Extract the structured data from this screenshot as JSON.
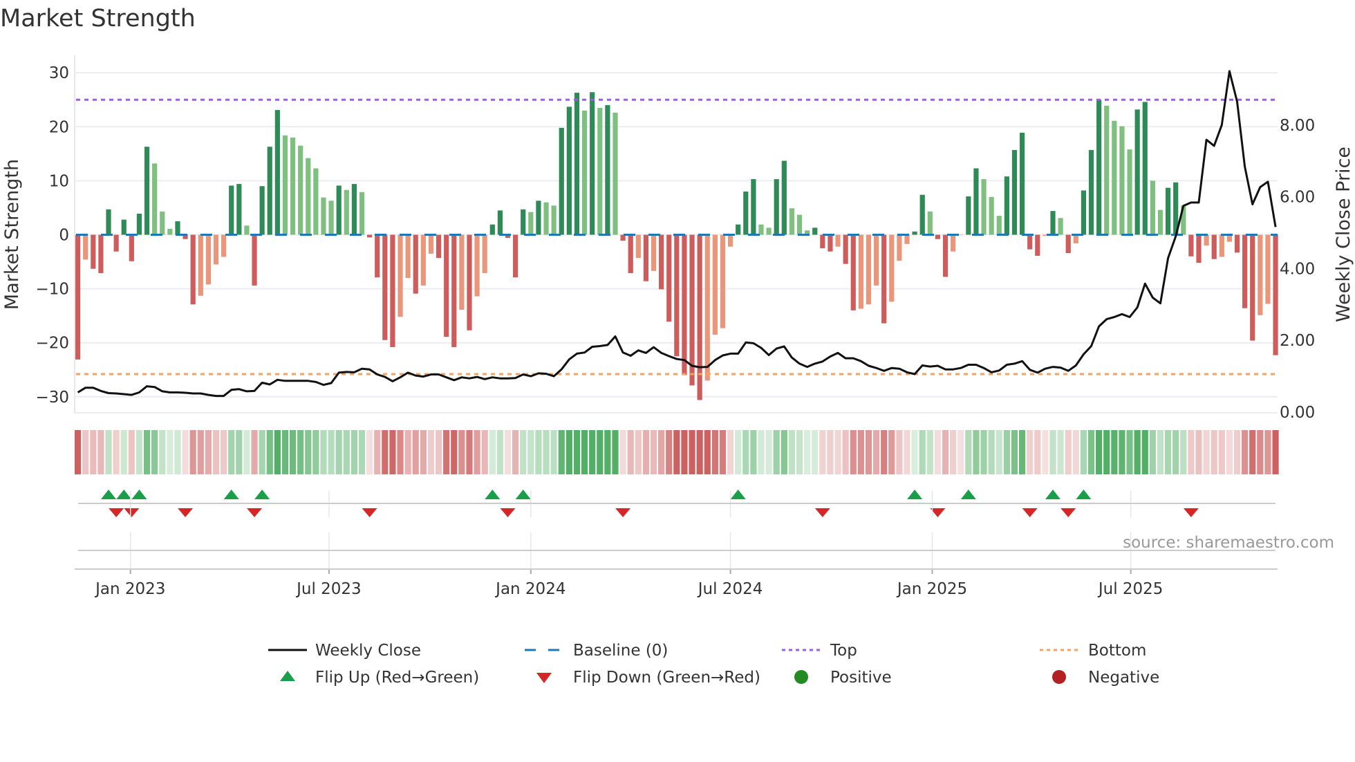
{
  "title": "Market Strength",
  "source": "source: sharemaestro.com",
  "colors": {
    "positive_rising": "#2e8b57",
    "positive_falling": "#7fbf7f",
    "negative_falling": "#cd5c5c",
    "negative_rising": "#e9967a",
    "baseline": "#1f77b4",
    "top": "#9b5de5",
    "bottom": "#f4a261",
    "flip_up": "#1a9e4a",
    "flip_down": "#d62728",
    "positive": "#228b22",
    "negative": "#b22222",
    "price_line": "#111111"
  },
  "legend": [
    {
      "label": "Weekly Close",
      "symbol": "solid-line"
    },
    {
      "label": "Baseline (0)",
      "symbol": "dashed-line"
    },
    {
      "label": "Top",
      "symbol": "dotted-line-purple"
    },
    {
      "label": "Bottom",
      "symbol": "dotted-line-orange"
    },
    {
      "label": "Flip Up (Red→Green)",
      "symbol": "triangle-up"
    },
    {
      "label": "Flip Down (Green→Red)",
      "symbol": "triangle-down"
    },
    {
      "label": "Positive",
      "symbol": "circle-green"
    },
    {
      "label": "Negative",
      "symbol": "circle-red"
    }
  ],
  "chart_data": {
    "type": "bar",
    "ylabel": "Market Strength",
    "y2label": "Weekly Close Price",
    "ylim": [
      -33,
      33
    ],
    "y2lim": [
      0,
      9.9
    ],
    "yticks": [
      {
        "value": 30,
        "label": "30"
      },
      {
        "value": 20,
        "label": "20"
      },
      {
        "value": 10,
        "label": "10"
      },
      {
        "value": 0,
        "label": "0"
      },
      {
        "value": -10,
        "label": "−10"
      },
      {
        "value": -20,
        "label": "−20"
      },
      {
        "value": -30,
        "label": "−30"
      }
    ],
    "y2ticks": [
      {
        "value": 0,
        "label": "0.00"
      },
      {
        "value": 2,
        "label": "2.00"
      },
      {
        "value": 4,
        "label": "4.00"
      },
      {
        "value": 6,
        "label": "6.00"
      },
      {
        "value": 8,
        "label": "8.00"
      }
    ],
    "xticks": [
      {
        "date": "2023-01-01",
        "label": "Jan 2023"
      },
      {
        "date": "2023-07-01",
        "label": "Jul 2023"
      },
      {
        "date": "2024-01-01",
        "label": "Jan 2024"
      },
      {
        "date": "2024-07-01",
        "label": "Jul 2024"
      },
      {
        "date": "2025-01-01",
        "label": "Jan 2025"
      },
      {
        "date": "2025-07-01",
        "label": "Jul 2025"
      }
    ],
    "grid": true,
    "legend_position": "bottom",
    "top_level": 25,
    "bottom_level": -25.8,
    "baseline": 0,
    "dates": [
      "2022-11-14",
      "2022-11-21",
      "2022-11-28",
      "2022-12-05",
      "2022-12-12",
      "2022-12-19",
      "2022-12-26",
      "2023-01-02",
      "2023-01-09",
      "2023-01-16",
      "2023-01-23",
      "2023-01-30",
      "2023-02-06",
      "2023-02-13",
      "2023-02-20",
      "2023-02-27",
      "2023-03-06",
      "2023-03-13",
      "2023-03-20",
      "2023-03-27",
      "2023-04-03",
      "2023-04-10",
      "2023-04-17",
      "2023-04-24",
      "2023-05-01",
      "2023-05-08",
      "2023-05-15",
      "2023-05-22",
      "2023-05-29",
      "2023-06-05",
      "2023-06-12",
      "2023-06-19",
      "2023-06-26",
      "2023-07-03",
      "2023-07-10",
      "2023-07-17",
      "2023-07-24",
      "2023-07-31",
      "2023-08-07",
      "2023-08-14",
      "2023-08-21",
      "2023-08-28",
      "2023-09-04",
      "2023-09-11",
      "2023-09-18",
      "2023-09-25",
      "2023-10-02",
      "2023-10-09",
      "2023-10-16",
      "2023-10-23",
      "2023-10-30",
      "2023-11-06",
      "2023-11-13",
      "2023-11-20",
      "2023-11-27",
      "2023-12-04",
      "2023-12-11",
      "2023-12-18",
      "2023-12-25",
      "2024-01-01",
      "2024-01-08",
      "2024-01-15",
      "2024-01-22",
      "2024-01-29",
      "2024-02-05",
      "2024-02-12",
      "2024-02-19",
      "2024-02-26",
      "2024-03-04",
      "2024-03-11",
      "2024-03-18",
      "2024-03-25",
      "2024-04-01",
      "2024-04-08",
      "2024-04-15",
      "2024-04-22",
      "2024-04-29",
      "2024-05-06",
      "2024-05-13",
      "2024-05-20",
      "2024-05-27",
      "2024-06-03",
      "2024-06-10",
      "2024-06-17",
      "2024-06-24",
      "2024-07-01",
      "2024-07-08",
      "2024-07-15",
      "2024-07-22",
      "2024-07-29",
      "2024-08-05",
      "2024-08-12",
      "2024-08-19",
      "2024-08-26",
      "2024-09-02",
      "2024-09-09",
      "2024-09-16",
      "2024-09-23",
      "2024-09-30",
      "2024-10-07",
      "2024-10-14",
      "2024-10-21",
      "2024-10-28",
      "2024-11-04",
      "2024-11-11",
      "2024-11-18",
      "2024-11-25",
      "2024-12-02",
      "2024-12-09",
      "2024-12-16",
      "2024-12-23",
      "2024-12-30",
      "2025-01-06",
      "2025-01-13",
      "2025-01-20",
      "2025-01-27",
      "2025-02-03",
      "2025-02-10",
      "2025-02-17",
      "2025-02-24",
      "2025-03-03",
      "2025-03-10",
      "2025-03-17",
      "2025-03-24",
      "2025-03-31",
      "2025-04-07",
      "2025-04-14",
      "2025-04-21",
      "2025-04-28",
      "2025-05-05",
      "2025-05-12",
      "2025-05-19",
      "2025-05-26",
      "2025-06-02",
      "2025-06-09",
      "2025-06-16",
      "2025-06-23",
      "2025-06-30",
      "2025-07-07",
      "2025-07-14",
      "2025-07-21",
      "2025-07-28",
      "2025-08-04",
      "2025-08-11",
      "2025-08-18",
      "2025-08-25",
      "2025-09-01",
      "2025-09-08",
      "2025-09-15",
      "2025-09-22",
      "2025-09-29",
      "2025-10-06",
      "2025-10-13",
      "2025-10-20",
      "2025-10-27",
      "2025-11-03",
      "2025-11-10"
    ],
    "series": [
      {
        "name": "Market Strength",
        "axis": "left",
        "type": "bar",
        "values": [
          -23.1,
          -4.6,
          -6.3,
          -7.1,
          4.7,
          -3.1,
          2.8,
          -4.9,
          3.9,
          16.3,
          13.2,
          4.3,
          1.1,
          2.5,
          -0.8,
          -12.9,
          -11.3,
          -9.2,
          -5.5,
          -4.1,
          9.1,
          9.4,
          1.7,
          -9.4,
          9.0,
          16.3,
          23.1,
          18.4,
          18.0,
          16.5,
          14.2,
          12.3,
          6.9,
          6.3,
          9.1,
          8.3,
          9.4,
          7.9,
          -0.5,
          -7.9,
          -19.5,
          -20.8,
          -15.2,
          -8.0,
          -10.9,
          -9.4,
          -3.5,
          -4.3,
          -18.9,
          -20.8,
          -13.9,
          -17.7,
          -11.4,
          -7.1,
          1.9,
          4.5,
          -0.6,
          -7.9,
          4.7,
          4.2,
          6.3,
          6.0,
          5.4,
          19.8,
          23.7,
          26.3,
          23.0,
          26.4,
          23.5,
          24.0,
          22.6,
          -1.1,
          -7.1,
          -4.3,
          -8.6,
          -6.7,
          -10.1,
          -16.1,
          -22.5,
          -26.0,
          -27.9,
          -30.6,
          -27.0,
          -18.5,
          -17.3,
          -2.2,
          1.9,
          8.0,
          10.3,
          1.9,
          1.3,
          10.3,
          13.7,
          4.9,
          3.7,
          0.8,
          1.3,
          -2.5,
          -3.1,
          -2.2,
          -5.4,
          -14.0,
          -13.7,
          -12.9,
          -9.4,
          -16.4,
          -12.4,
          -4.8,
          -1.7,
          0.6,
          7.4,
          4.3,
          -0.8,
          -7.8,
          -3.1,
          0,
          7.1,
          12.3,
          10.3,
          7.0,
          3.5,
          10.8,
          15.7,
          18.9,
          -2.7,
          -3.9,
          -0.2,
          4.4,
          3.1,
          -3.4,
          -1.6,
          8.2,
          15.7,
          25.0,
          23.9,
          21.1,
          20.1,
          15.8,
          23.2,
          24.6,
          10.0,
          4.6,
          8.7,
          9.7,
          5.4,
          -4.0,
          -5.2,
          -2.0,
          -4.5,
          -4.1,
          -1.3,
          -3.3,
          -13.6,
          -19.6,
          -14.9,
          -12.8,
          -22.3
        ]
      },
      {
        "name": "Weekly Close",
        "axis": "right",
        "type": "line",
        "values": [
          0.55,
          0.68,
          0.68,
          0.59,
          0.53,
          0.52,
          0.5,
          0.48,
          0.55,
          0.72,
          0.7,
          0.58,
          0.55,
          0.55,
          0.54,
          0.52,
          0.52,
          0.48,
          0.45,
          0.45,
          0.62,
          0.64,
          0.58,
          0.59,
          0.82,
          0.77,
          0.9,
          0.87,
          0.87,
          0.87,
          0.87,
          0.84,
          0.76,
          0.81,
          1.1,
          1.12,
          1.11,
          1.21,
          1.19,
          1.05,
          0.98,
          0.86,
          0.97,
          1.1,
          1.02,
          0.99,
          1.05,
          1.05,
          0.97,
          0.89,
          0.97,
          0.94,
          0.98,
          0.92,
          0.97,
          0.94,
          0.94,
          0.95,
          1.05,
          1.0,
          1.08,
          1.07,
          1.0,
          1.19,
          1.47,
          1.63,
          1.66,
          1.82,
          1.84,
          1.87,
          2.11,
          1.66,
          1.57,
          1.72,
          1.65,
          1.81,
          1.65,
          1.56,
          1.48,
          1.45,
          1.29,
          1.25,
          1.26,
          1.45,
          1.58,
          1.63,
          1.63,
          1.94,
          1.92,
          1.79,
          1.59,
          1.77,
          1.83,
          1.52,
          1.35,
          1.26,
          1.35,
          1.41,
          1.55,
          1.65,
          1.5,
          1.5,
          1.42,
          1.29,
          1.23,
          1.15,
          1.23,
          1.21,
          1.11,
          1.06,
          1.3,
          1.27,
          1.29,
          1.19,
          1.19,
          1.23,
          1.32,
          1.32,
          1.23,
          1.11,
          1.16,
          1.32,
          1.35,
          1.42,
          1.18,
          1.1,
          1.21,
          1.26,
          1.24,
          1.15,
          1.3,
          1.61,
          1.84,
          2.39,
          2.59,
          2.65,
          2.73,
          2.65,
          2.92,
          3.58,
          3.19,
          3.03,
          4.29,
          4.9,
          5.75,
          5.84,
          5.84,
          7.59,
          7.42,
          8.0,
          9.5,
          8.65,
          6.84,
          5.79,
          6.27,
          6.42,
          5.16
        ]
      }
    ],
    "flip_up_dates": [
      "2022-12-12",
      "2022-12-26",
      "2023-01-09",
      "2023-04-03",
      "2023-05-01",
      "2023-11-27",
      "2023-12-25",
      "2024-07-08",
      "2024-12-16",
      "2025-02-03",
      "2025-04-21",
      "2025-05-19"
    ],
    "flip_down_dates": [
      "2022-12-19",
      "2023-01-02",
      "2023-02-20",
      "2023-04-24",
      "2023-08-07",
      "2023-12-11",
      "2024-03-25",
      "2024-09-23",
      "2025-01-06",
      "2025-03-31",
      "2025-05-05",
      "2025-08-25"
    ]
  }
}
